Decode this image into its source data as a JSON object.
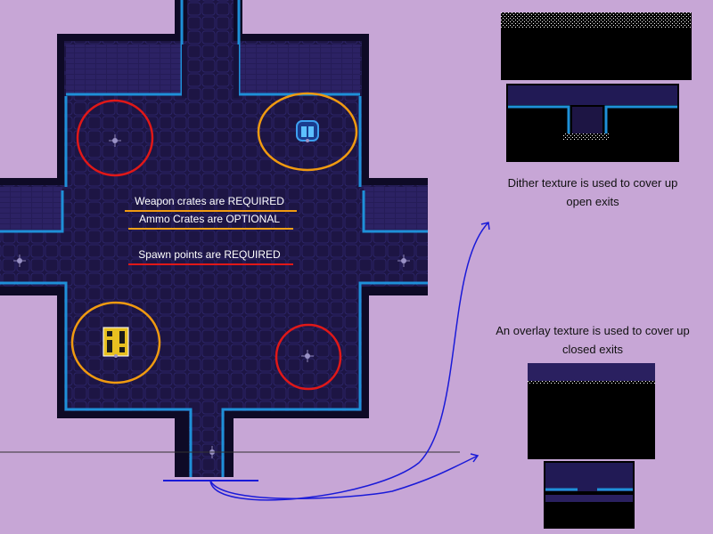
{
  "labels": {
    "weapon_crates": "Weapon crates are REQUIRED",
    "ammo_crates": "Ammo Crates are OPTIONAL",
    "spawn_points": "Spawn points are REQUIRED"
  },
  "notes": {
    "dither_line1": "Dither texture is used to cover up",
    "dither_line2": "open exits",
    "overlay_line1": "An overlay texture is used to cover up",
    "overlay_line2": "closed exits"
  },
  "colors": {
    "background": "#c7a6d6",
    "floor": "#1d1544",
    "wall": "#2a2060",
    "void": "#000000",
    "trim": "#1e90d8",
    "spawn_circle": "#e01818",
    "ammo_circle": "#f09a10",
    "weapon_underline": "#f09a10",
    "ammo_underline": "#f0a018",
    "spawn_underline": "#e01818",
    "arrow": "#1a1ad8"
  },
  "legend_icons": [
    "spawn-point-icon",
    "weapon-crate-icon",
    "ammo-crate-icon"
  ]
}
